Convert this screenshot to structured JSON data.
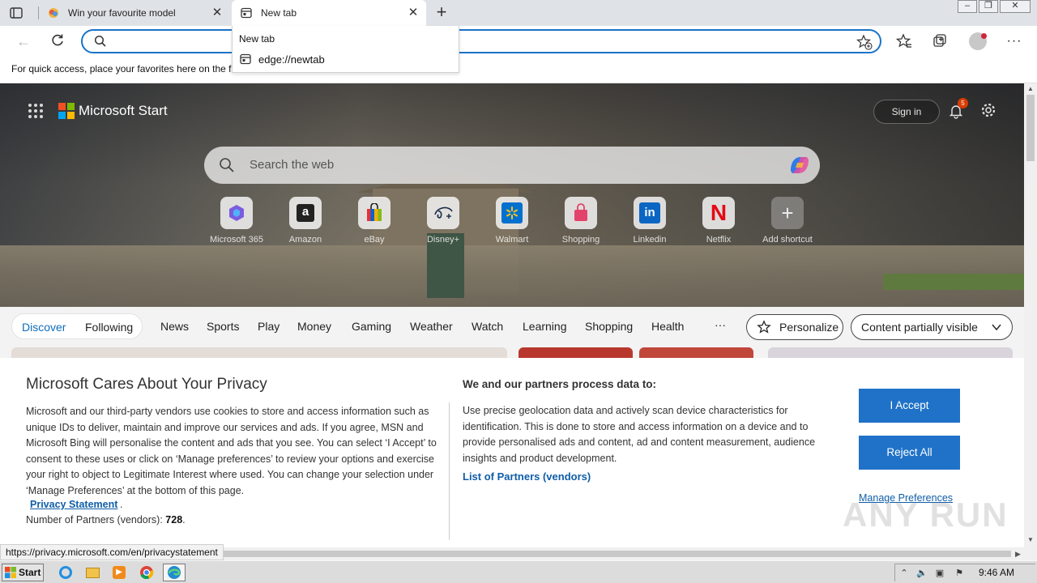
{
  "tabs": [
    {
      "title": "Win your favourite model",
      "active": false
    },
    {
      "title": "New tab",
      "active": true
    }
  ],
  "omnibox": {
    "value": "",
    "placeholder": ""
  },
  "favorites_bar": {
    "hint": "For quick access, place your favorites here on the fa"
  },
  "suggestions": {
    "header": "New tab",
    "items": [
      "edge://newtab"
    ]
  },
  "page": {
    "brand": "Microsoft Start",
    "sign_in": "Sign in",
    "notification_count": "5",
    "search_placeholder": "Search the web",
    "shortcuts": [
      "Microsoft 365",
      "Amazon",
      "eBay",
      "Disney+",
      "Walmart",
      "Shopping",
      "Linkedin",
      "Netflix",
      "Add shortcut"
    ],
    "feed_nav": {
      "discover": "Discover",
      "following": "Following",
      "items": [
        "News",
        "Sports",
        "Play",
        "Money",
        "Gaming",
        "Weather",
        "Watch",
        "Learning",
        "Shopping",
        "Health"
      ],
      "more": "···",
      "personalize": "Personalize",
      "content_visibility": "Content partially visible"
    }
  },
  "privacy": {
    "heading": "Microsoft Cares About Your Privacy",
    "body": "Microsoft and our third-party vendors use cookies to store and access information such as unique IDs to deliver, maintain and improve our services and ads. If you agree, MSN and Microsoft Bing will personalise the content and ads that you see. You can select ‘I Accept’ to consent to these uses or click on ‘Manage preferences’ to review your options and exercise your right to object to Legitimate Interest where used.  You can change your selection under ‘Manage Preferences’ at the bottom of this page.",
    "privacy_statement": "Privacy Statement",
    "partners_label": "Number of Partners (vendors): ",
    "partners_count": "728",
    "process_heading": "We and our partners process data to:",
    "process_body": "Use precise geolocation data and actively scan device characteristics for identification. This is done to store and access information on a device and to provide personalised ads and content, ad and content measurement, audience insights and product development.",
    "list_partners": "List of Partners (vendors)",
    "accept": "I Accept",
    "reject": "Reject All",
    "manage": "Manage Preferences"
  },
  "status_url": "https://privacy.microsoft.com/en/privacystatement",
  "watermark": "ANY RUN",
  "taskbar": {
    "start": "Start",
    "clock": "9:46 AM"
  },
  "colors": {
    "accent": "#1f72c7",
    "link": "#0f5ea8",
    "omnibox_border": "#1a73c8"
  }
}
